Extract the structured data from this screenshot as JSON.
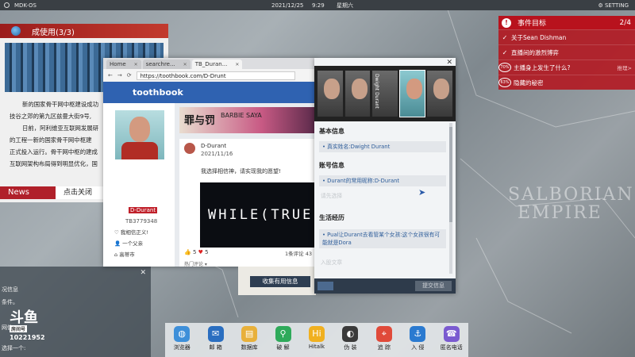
{
  "topbar": {
    "os_name": "MDK-OS",
    "date": "2021/12/25",
    "time": "9:29",
    "weekday": "星期六",
    "setting": "SETTING"
  },
  "map": {
    "labels": [
      "SALBORIAN",
      "EMPIRE"
    ]
  },
  "news_panel": {
    "title": "成使用(3/3)",
    "paragraphs": [
      "新的国家骨干网中枢建设成功",
      "技谷之郊的第九区兹曼大街9号,",
      "日前，阿利维亚互联网发展研",
      "的工程一新的国家骨干网中枢建",
      "正式投入运行。骨干网中枢的建成",
      "互联网架构布局得到明显优化，国"
    ],
    "tag": "News",
    "close_label": "点击关闭"
  },
  "left_lower": {
    "lines": [
      "况信息",
      "条件。",
      "网信",
      "选择一个:"
    ]
  },
  "watermark": {
    "logo": "斗鱼",
    "room_label": "房间号",
    "room_number": "10221952"
  },
  "browser": {
    "tabs": [
      {
        "label": "Home"
      },
      {
        "label": "searchre..."
      },
      {
        "label": "TB_Duran..."
      }
    ],
    "url": "https://toothbook.com/D-Drunt",
    "site_name": "toothbook",
    "profile": {
      "name": "D-Durant",
      "id": "TB3779348",
      "items": [
        "我相信正义!",
        "一个父亲",
        "高蒂市"
      ]
    },
    "banner": {
      "title": "罪与罚",
      "subtitle": "BARBIE SAYA"
    },
    "post": {
      "author": "D-Durant",
      "date": "2021/11/16",
      "text": "我选择相信神，请实现我的愿望!",
      "image_text": "WHILE(TRUE)",
      "likes": "5",
      "hearts": "5",
      "comments": "1条评论",
      "comments_more": "43",
      "hot_label": "热门评论"
    }
  },
  "collect_button": "收集有用信息",
  "dossier": {
    "portrait_label": "Dwight Durant",
    "sections": [
      {
        "title": "基本信息",
        "items": [
          "真实姓名:Dwight Durant"
        ],
        "placeholder": ""
      },
      {
        "title": "账号信息",
        "items": [
          "Durant的常用昵称:D-Durant"
        ],
        "placeholder": "请先选择"
      },
      {
        "title": "生活经历",
        "items": [
          "Pual让Durant去看管某个女孩:这个女孩很有可能就是Dora"
        ],
        "placeholder": "入股文章"
      }
    ],
    "submit_label": "提交信息"
  },
  "events": {
    "title": "事件目标",
    "count": "2/4",
    "items": [
      {
        "label": "关于Sean Dishman",
        "mark": "✓"
      },
      {
        "label": "直播间的激烈博弈",
        "mark": "✓"
      },
      {
        "label": "主播身上发生了什么?",
        "progress": "70%",
        "action": "推理>"
      },
      {
        "label": "隐藏的秘密",
        "progress": "63%"
      }
    ]
  },
  "taskbar": {
    "apps": [
      {
        "label": "浏览器",
        "icon": "browser-icon",
        "color": "#3d8fd9"
      },
      {
        "label": "邮 箱",
        "icon": "mail-icon",
        "color": "#2a6ec0"
      },
      {
        "label": "数据库",
        "icon": "database-icon",
        "color": "#e8b03a"
      },
      {
        "label": "破 解",
        "icon": "crack-icon",
        "color": "#2eaa5a"
      },
      {
        "label": "Hitalk",
        "icon": "hitalk-icon",
        "color": "#f0b020"
      },
      {
        "label": "伪 装",
        "icon": "disguise-icon",
        "color": "#3a3a3a"
      },
      {
        "label": "追 踪",
        "icon": "track-icon",
        "color": "#e04a3a"
      },
      {
        "label": "入 侵",
        "icon": "intrude-icon",
        "color": "#2a7ad0"
      },
      {
        "label": "匿名电话",
        "icon": "phone-icon",
        "color": "#7a5ad0"
      }
    ]
  }
}
